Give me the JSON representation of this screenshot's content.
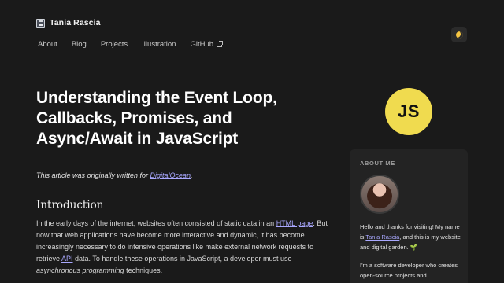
{
  "header": {
    "brand_icon": "floppy-disk-icon",
    "brand_name": "Tania Rascia",
    "theme_icon": "moon-icon"
  },
  "nav": {
    "items": [
      "About",
      "Blog",
      "Projects",
      "Illustration",
      "GitHub"
    ],
    "external_icon": "external-link-icon"
  },
  "article": {
    "title": "Understanding the Event Loop, Callbacks, Promises, and Async/Await in JavaScript",
    "note_prefix": "This article was originally written for ",
    "note_link": "DigitalOcean",
    "note_suffix": ".",
    "section_heading": "Introduction",
    "para_1": "In the early days of the internet, websites often consisted of static data in an ",
    "para_link_1": "HTML page",
    "para_2": ". But now that web applications have become more interactive and dynamic, it has become increasingly necessary to do intensive operations like make external network requests to retrieve ",
    "para_link_2": "API",
    "para_3": " data. To handle these operations in JavaScript, a developer must use ",
    "para_em": "asynchronous programming",
    "para_4": " techniques."
  },
  "logo": {
    "text": "JS",
    "color": "#f0db4f"
  },
  "sidebar": {
    "heading": "ABOUT ME",
    "p1_a": "Hello and thanks for visiting! My name is ",
    "p1_link": "Tania Rascia",
    "p1_b": ", and this is my website and digital garden. ",
    "p1_emoji": "🌱",
    "p2": "I'm a software developer who creates open-source projects and"
  },
  "colors": {
    "background": "#1a1a1a",
    "link": "#a9a8ff",
    "card": "#232323"
  }
}
